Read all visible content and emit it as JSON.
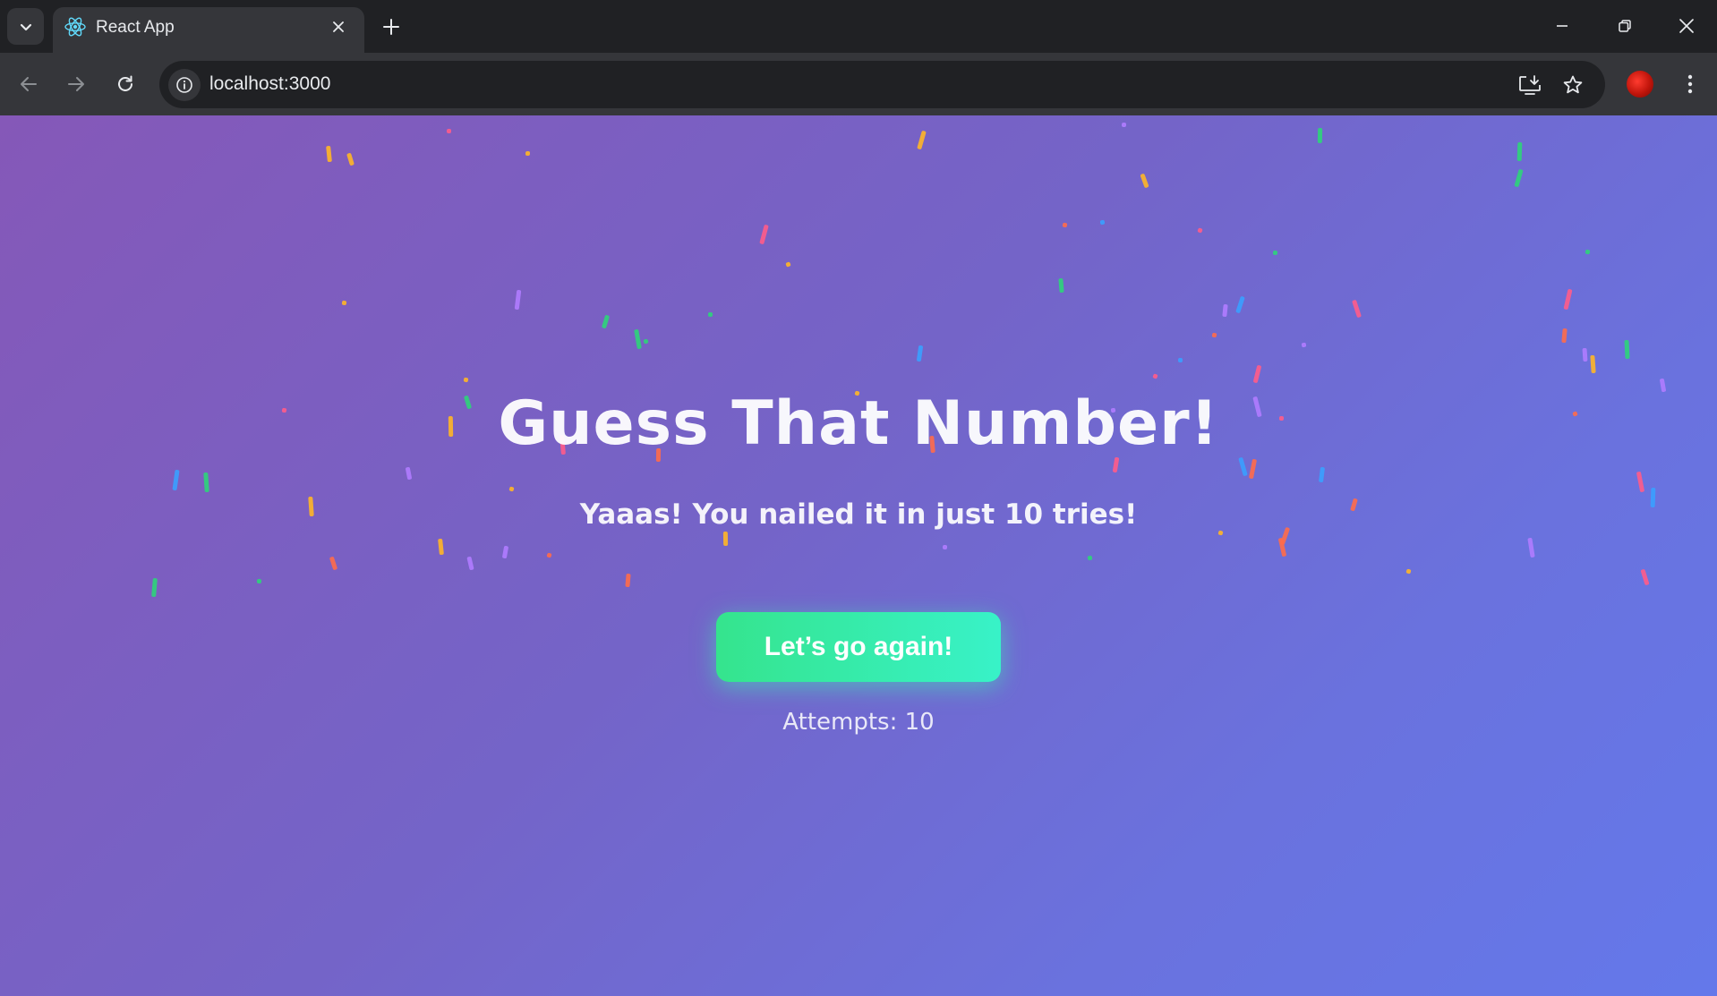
{
  "browser": {
    "tab": {
      "title": "React App"
    },
    "address_bar": {
      "url": "localhost:3000"
    },
    "icons": [
      "tab-search-icon",
      "react-logo-icon",
      "close-icon",
      "plus-icon",
      "minimize-icon",
      "restore-icon",
      "window-close-icon",
      "back-arrow-icon",
      "forward-arrow-icon",
      "reload-icon",
      "site-info-icon",
      "install-app-icon",
      "bookmark-star-icon",
      "profile-avatar",
      "kebab-menu-icon"
    ]
  },
  "page": {
    "title": "Guess That Number!",
    "message": "Yaaas! You nailed it in just 10 tries!",
    "play_again_label": "Let’s go again!",
    "attempts_text": "Attempts: 10"
  },
  "colors": {
    "background_start": "#8558b8",
    "background_end": "#6478ea",
    "button_start": "#35e48d",
    "button_end": "#38f2c8",
    "confetti": [
      "#ffb627",
      "#2ed47a",
      "#ff5c8a",
      "#3aa0ff",
      "#b07cff",
      "#ff6b4a"
    ]
  }
}
